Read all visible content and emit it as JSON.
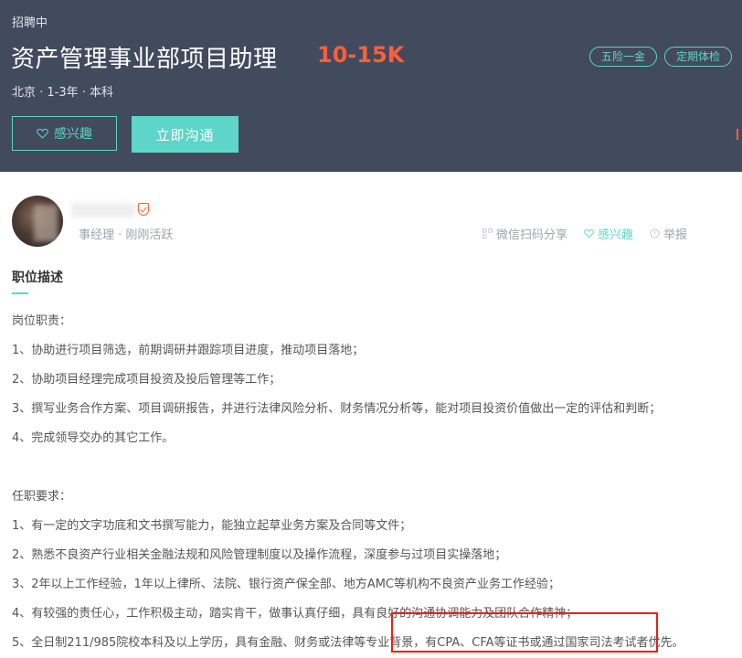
{
  "header": {
    "status": "招聘中",
    "title": "资产管理事业部项目助理",
    "salary": "10-15K",
    "meta": "北京 · 1-3年 · 本科",
    "tags": [
      "五险一金",
      "定期体检"
    ],
    "like_button": "感兴趣",
    "chat_button": "立即沟通"
  },
  "recruiter": {
    "meta": "事经理 · 刚刚活跃",
    "actions": {
      "share": "微信扫码分享",
      "like": "感兴趣",
      "report": "举报"
    }
  },
  "section": {
    "title": "职位描述"
  },
  "description": {
    "duties_heading": "岗位职责：",
    "duties": [
      "1、协助进行项目筛选，前期调研并跟踪项目进度，推动项目落地；",
      "2、协助项目经理完成项目投资及投后管理等工作；",
      "3、撰写业务合作方案、项目调研报告，并进行法律风险分析、财务情况分析等，能对项目投资价值做出一定的评估和判断；",
      "4、完成领导交办的其它工作。"
    ],
    "req_heading": "任职要求：",
    "requirements": [
      "1、有一定的文字功底和文书撰写能力，能独立起草业务方案及合同等文件；",
      "2、熟悉不良资产行业相关金融法规和风险管理制度以及操作流程，深度参与过项目实操落地；",
      "3、2年以上工作经验，1年以上律所、法院、银行资产保全部、地方AMC等机构不良资产业务工作经验；",
      "4、有较强的责任心，工作积极主动，踏实肯干，做事认真仔细，具有良好的沟通协调能力及团队合作精神；",
      "5、全日制211/985院校本科及以上学历，具有金融、财务或法律等专业背景，有CPA、CFA等证书或通过国家司法考试者优先。"
    ]
  },
  "colors": {
    "header_bg": "#424a5e",
    "accent": "#5dd5c8",
    "salary": "#fd5f39",
    "highlight": "#e8211a"
  }
}
